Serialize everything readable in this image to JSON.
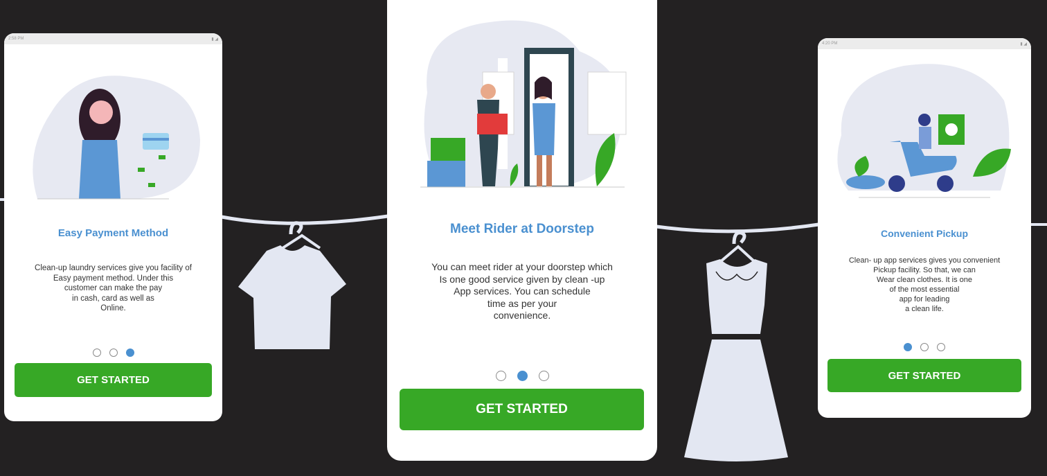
{
  "screens": [
    {
      "status_time": "2:58 PM",
      "title": "Easy Payment Method",
      "description": "Clean-up laundry services give you facility of\nEasy payment method. Under this\ncustomer can make the pay\nin cash, card as well as\nOnline.",
      "button": "GET STARTED",
      "active_dot": 2
    },
    {
      "title": "Meet Rider at Doorstep",
      "description": "You can meet rider at your doorstep which\nIs one good service given by clean -up\nApp services. You can schedule\ntime as per your\nconvenience.",
      "button": "GET STARTED",
      "active_dot": 1
    },
    {
      "status_time": "4:20 PM",
      "title": "Convenient Pickup",
      "description": "Clean- up app services gives you convenient\nPickup facility. So that, we can\nWear clean clothes. It is one\nof the most essential\napp for leading\na clean life.",
      "button": "GET STARTED",
      "active_dot": 0
    }
  ],
  "colors": {
    "background": "#232122",
    "accent_blue": "#4a90d0",
    "button_green": "#37a826",
    "garment": "#e3e7f2"
  },
  "icons": [
    "signal-icon",
    "battery-icon",
    "t-shirt-icon",
    "dress-icon",
    "hanger-icon"
  ]
}
